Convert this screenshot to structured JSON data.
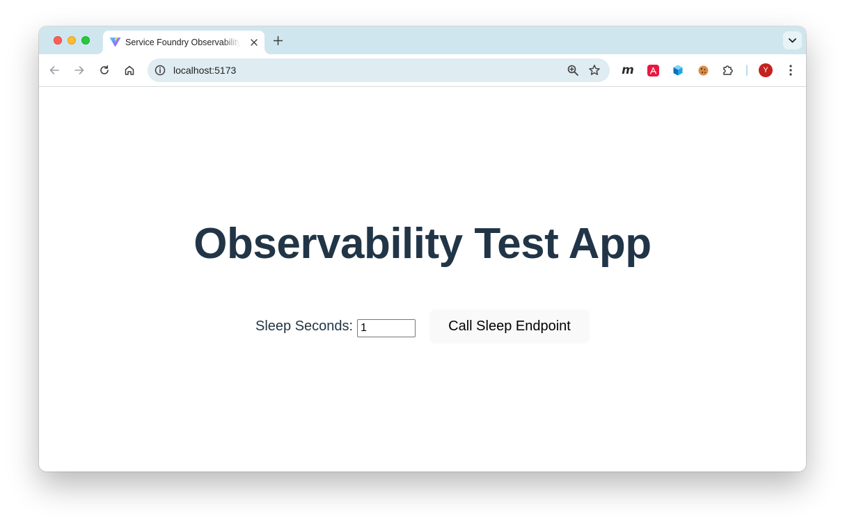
{
  "browser": {
    "tab": {
      "title": "Service Foundry Observability Test App",
      "favicon": "vite-logo-icon"
    },
    "address_bar": {
      "url": "localhost:5173"
    },
    "profile_initial": "Y",
    "extensions": [
      "m-extension-icon",
      "adobe-acrobat-icon",
      "cube-extension-icon",
      "cookie-icon",
      "puzzle-extensions-icon"
    ],
    "colors": {
      "tabstrip": "#cfe6ee",
      "omnibox": "#dfecf1",
      "avatar": "#c5221f"
    }
  },
  "page": {
    "heading": "Observability Test App",
    "sleep_label": "Sleep Seconds:",
    "sleep_value": "1",
    "call_button_label": "Call Sleep Endpoint",
    "colors": {
      "text": "#213547",
      "button_bg": "#f9f9f9"
    }
  }
}
